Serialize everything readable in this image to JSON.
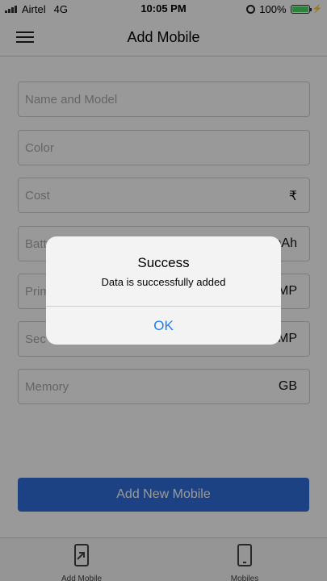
{
  "status_bar": {
    "carrier": "Airtel",
    "network": "4G",
    "time": "10:05 PM",
    "battery": "100%",
    "battery_level": 1.0
  },
  "nav": {
    "title": "Add Mobile",
    "menu_icon": "hamburger-menu-icon"
  },
  "form": {
    "fields": [
      {
        "placeholder": "Name and Model",
        "unit": ""
      },
      {
        "placeholder": "Color",
        "unit": ""
      },
      {
        "placeholder": "Cost",
        "unit": "₹"
      },
      {
        "placeholder": "Batt",
        "unit": "mAh"
      },
      {
        "placeholder": "Prim",
        "unit": "MP"
      },
      {
        "placeholder": "Sec",
        "unit": "MP"
      },
      {
        "placeholder": "Memory",
        "unit": "GB"
      }
    ],
    "submit_label": "Add New Mobile"
  },
  "tabs": [
    {
      "label": "Add Mobile",
      "icon": "add-mobile-icon"
    },
    {
      "label": "Mobiles",
      "icon": "mobile-phone-icon"
    }
  ],
  "alert": {
    "title": "Success",
    "message": "Data is successfully added",
    "ok_label": "OK"
  },
  "colors": {
    "primary_button": "#2f6fdb",
    "alert_button": "#1f7cf5",
    "battery": "#4cd964"
  }
}
